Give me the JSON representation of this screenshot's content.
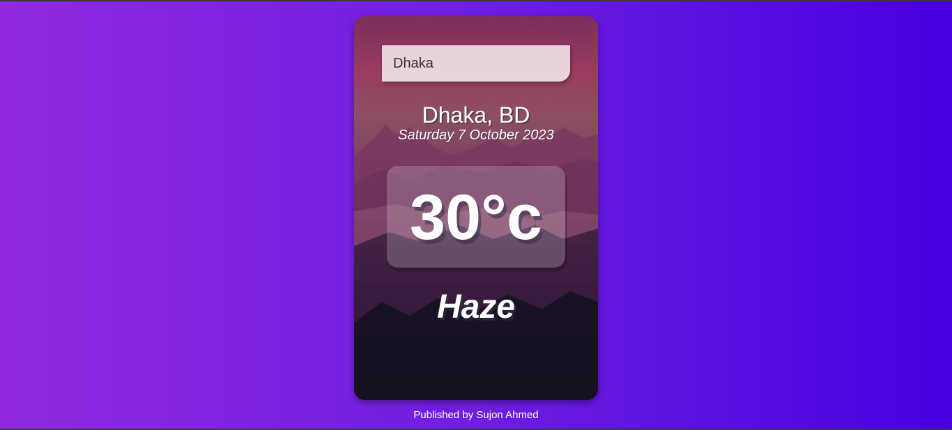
{
  "search": {
    "value": "Dhaka"
  },
  "location": {
    "city_country": "Dhaka, BD",
    "date": "Saturday 7 October 2023"
  },
  "current": {
    "temperature": "30°c",
    "condition": "Haze"
  },
  "footer": {
    "text": "Published by Sujon Ahmed"
  },
  "colors": {
    "background_start": "#9229e0",
    "background_end": "#4a00e0",
    "text": "#ffffff"
  }
}
